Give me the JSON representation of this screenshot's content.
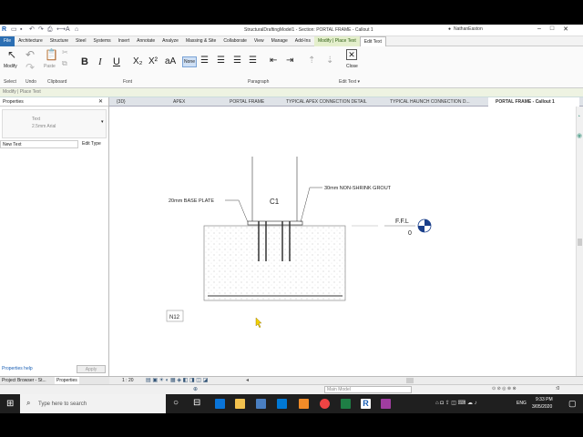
{
  "window": {
    "title": "StructuralDraftingModel1 - Section: PORTAL FRAME - Callout 1",
    "user": "NathanEaston"
  },
  "ribbon_tabs": [
    "File",
    "Architecture",
    "Structure",
    "Steel",
    "Systems",
    "Insert",
    "Annotate",
    "Analyze",
    "Massing & Site",
    "Collaborate",
    "View",
    "Manage",
    "Add-Ins",
    "Modify | Place Text",
    "Edit Text"
  ],
  "ribbon_groups": {
    "select": "Select",
    "undo": "Undo",
    "clipboard": "Clipboard",
    "font": "Font",
    "paragraph": "Paragraph",
    "edit_text": "Edit Text ▾"
  },
  "ribbon_buttons": {
    "modify": "Modify",
    "paste": "Paste",
    "bold": "B",
    "italic": "I",
    "underline": "U",
    "subscript": "X₂",
    "superscript": "X²",
    "all_caps": "aA",
    "none": "None",
    "close": "Close"
  },
  "options_bar": "Modify | Place Text",
  "properties": {
    "header": "Properties",
    "type_family": "Text",
    "type_name": "2.5mm Arial",
    "instance": "New Text",
    "edit_type": "Edit Type",
    "help": "Properties help",
    "apply": "Apply"
  },
  "bottom_tabs": {
    "browser": "Project Browser - St...",
    "properties": "Properties"
  },
  "view_tabs": [
    "{3D}",
    "APEX",
    "PORTAL FRAME",
    "TYPICAL APEX CONNECTION DETAIL",
    "TYPICAL HAUNCH CONNECTION D...",
    "PORTAL FRAME - Callout 1"
  ],
  "drawing": {
    "label_column": "C1",
    "label_plate": "20mm BASE PLATE",
    "label_grout": "30mm NON-SHRINK GROUT",
    "level_name": "F.F.L",
    "level_value": "0",
    "text_box": "N12"
  },
  "view_bar": {
    "scale": "1 : 20"
  },
  "status_bar": {
    "model": "Main Model",
    "filter": ":0"
  },
  "taskbar": {
    "search_placeholder": "Type here to search",
    "time": "9:33 PM",
    "date": "3/05/2020",
    "lang": "ENG"
  }
}
